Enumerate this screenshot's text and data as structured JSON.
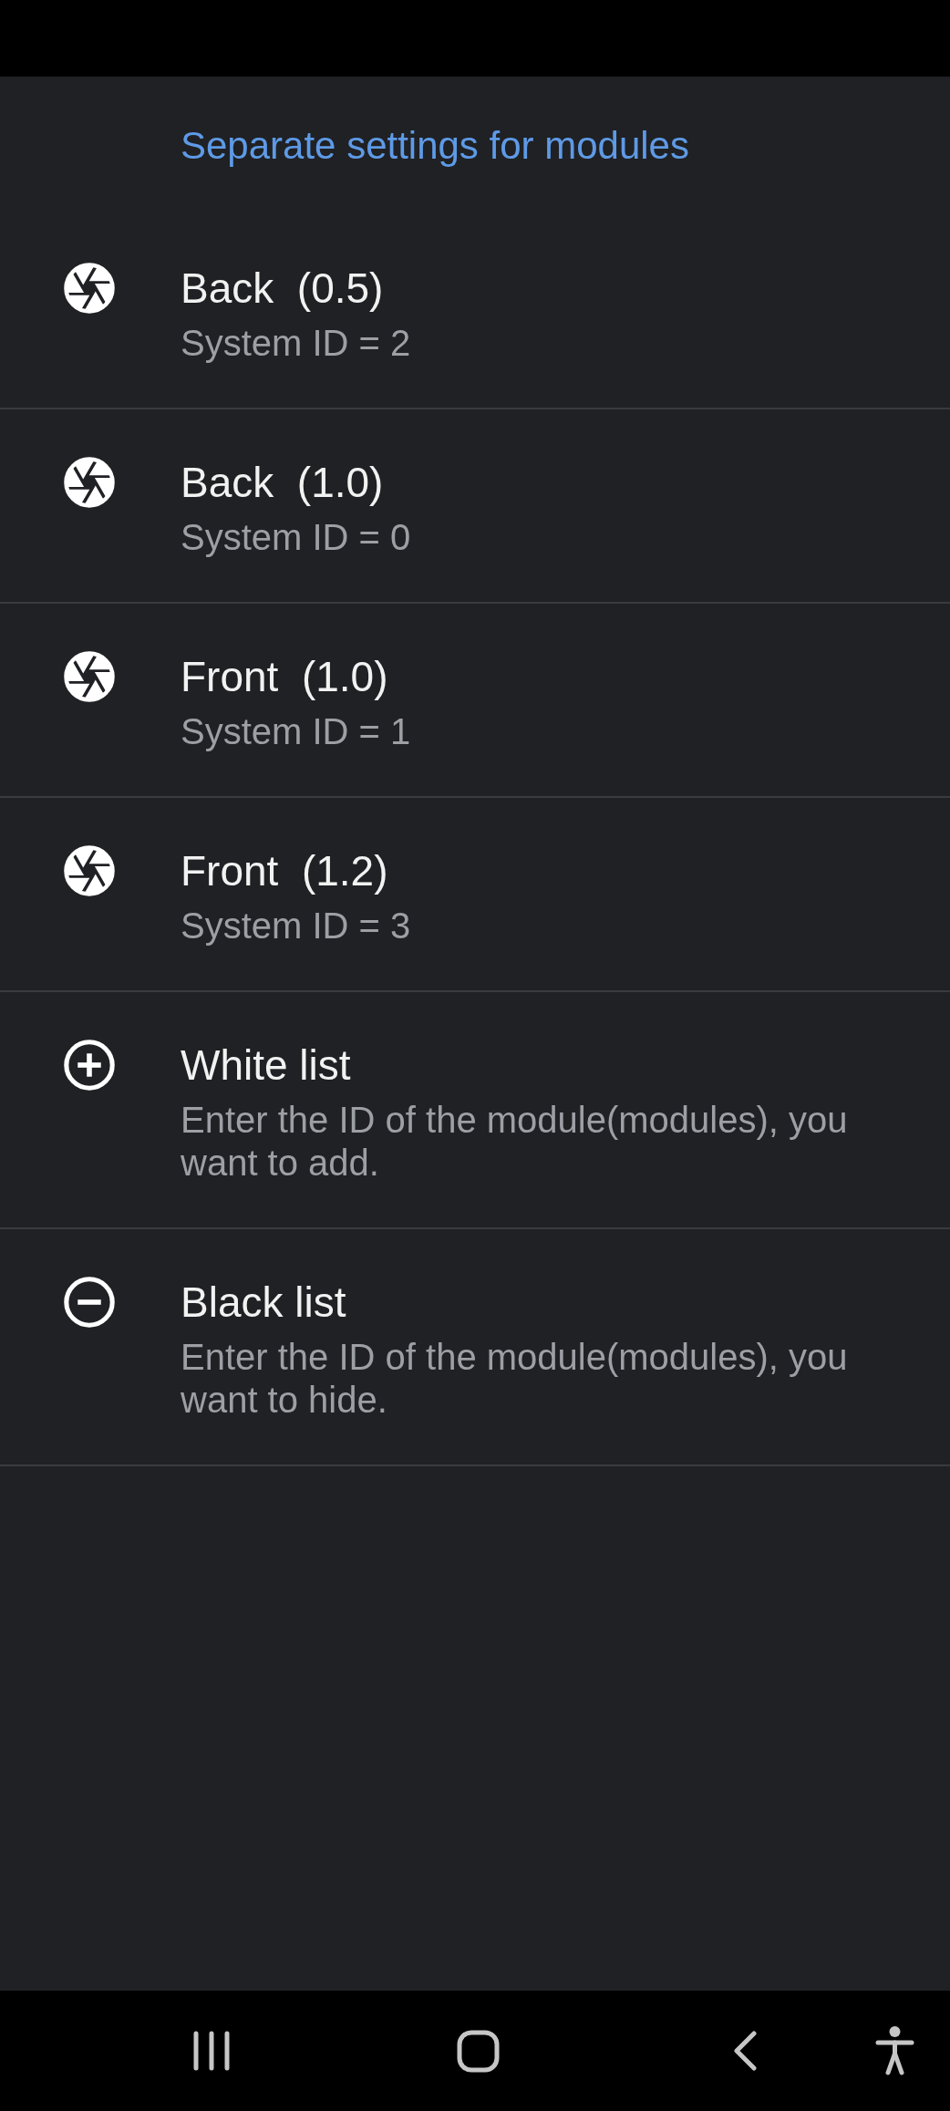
{
  "header": {
    "title": "Separate settings for modules"
  },
  "items": [
    {
      "kind": "camera",
      "title": "Back  (0.5)",
      "summary": "System ID = 2"
    },
    {
      "kind": "camera",
      "title": "Back  (1.0)",
      "summary": "System ID = 0"
    },
    {
      "kind": "camera",
      "title": "Front  (1.0)",
      "summary": "System ID = 1"
    },
    {
      "kind": "camera",
      "title": "Front  (1.2)",
      "summary": "System ID = 3"
    },
    {
      "kind": "add",
      "title": "White list",
      "summary": "Enter the ID of the module(modules), you want to add."
    },
    {
      "kind": "remove",
      "title": "Black list",
      "summary": "Enter the ID of the module(modules), you want to hide."
    }
  ]
}
